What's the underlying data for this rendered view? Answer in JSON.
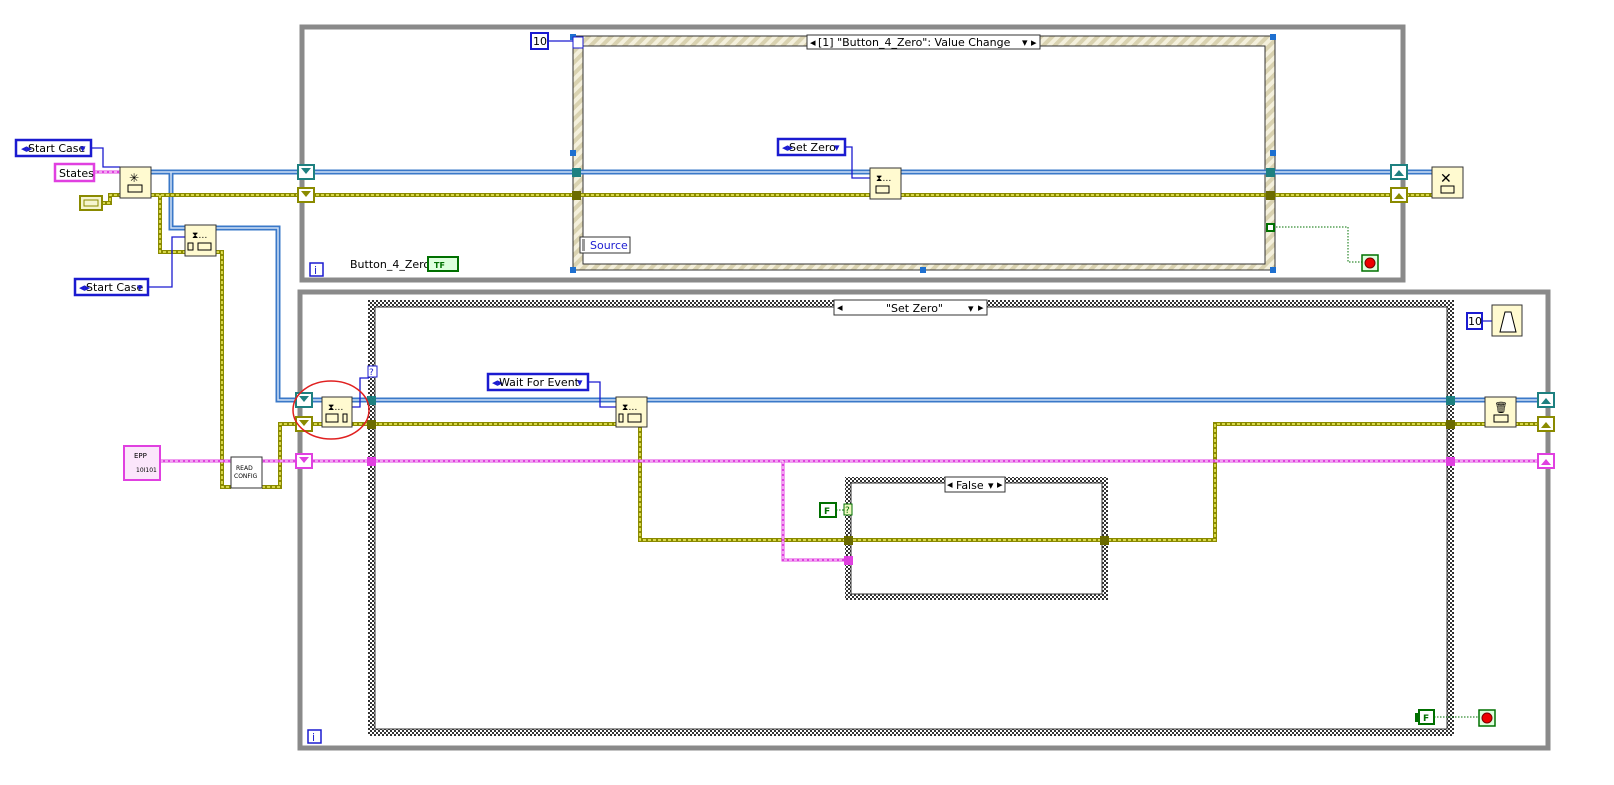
{
  "diagram": {
    "left": {
      "start_case_1": "Start Case",
      "states_label": "States",
      "start_case_2": "Start Case",
      "epp_label": "EPP",
      "epp_glyph": "10I101",
      "read_config": [
        "READ",
        "CONFIG"
      ]
    },
    "event_loop": {
      "timeout_constant": "10",
      "event_selector": "[1] \"Button_4_Zero\": Value Change",
      "source_label": "Source",
      "set_zero_enum": "Set Zero",
      "button_label": "Button_4_Zero",
      "button_terminal": "TF",
      "iteration_terminal": "i"
    },
    "consumer_loop": {
      "case_selector": "\"Set Zero\"",
      "wait_for_event_enum": "Wait For Event",
      "inner_case_selector": "False",
      "false_constant": "F",
      "false_constant_2": "F",
      "metronome_constant": "10",
      "error_case_terminal": "?",
      "inner_case_terminal": "?",
      "iteration_terminal": "i"
    },
    "annotation_color": "#e02020",
    "wire_colors": {
      "queue": "#3a78c8",
      "error": "#c8c800",
      "string": "#e040e0",
      "boolean": "#007000"
    }
  }
}
